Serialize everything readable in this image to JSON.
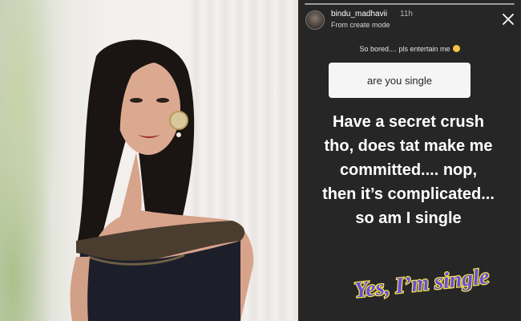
{
  "story": {
    "username": "bindu_madhavii",
    "time_ago": "11h",
    "subline": "From create mode",
    "question_prompt": "So bored.... pls entertain me",
    "question_answer": "are you single",
    "reply_lines": [
      "Have a secret crush",
      "tho, does tat make me",
      "committed.... nop,",
      "then it’s complicated...",
      "so am I single"
    ],
    "sticker_text": "Yes, I’m single",
    "icons": {
      "close": "close-icon",
      "emoji": "smile-emoji-icon",
      "avatar": "avatar"
    }
  },
  "colors": {
    "story_bg": "#262626",
    "sticker_fill": "#6a4ce0",
    "sticker_outline": "#f2e64a"
  }
}
